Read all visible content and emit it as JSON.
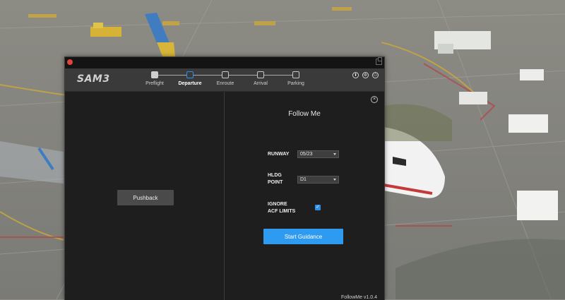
{
  "app": {
    "logo": "SAM3"
  },
  "stepper": {
    "steps": [
      {
        "label": "Preflight",
        "state": "done"
      },
      {
        "label": "Departure",
        "state": "active"
      },
      {
        "label": "Enroute",
        "state": "pending"
      },
      {
        "label": "Arrival",
        "state": "pending"
      },
      {
        "label": "Parking",
        "state": "pending"
      }
    ]
  },
  "header_buttons": [
    {
      "icon": "upload-icon",
      "glyph": "⬆"
    },
    {
      "icon": "settings-icon",
      "glyph": "⚙"
    },
    {
      "icon": "power-icon",
      "glyph": "⏻"
    }
  ],
  "left_panel": {
    "pushback_label": "Pushback"
  },
  "follow_me": {
    "title": "Follow Me",
    "close_glyph": "×",
    "runway": {
      "label": "RUNWAY",
      "value": "05/23"
    },
    "holding_point": {
      "label_line1": "HLDG",
      "label_line2": "POINT",
      "value": "D1"
    },
    "ignore_limits": {
      "label_line1": "IGNORE",
      "label_line2": "ACF LIMITS",
      "checked": true,
      "glyph": "✓"
    },
    "start_label": "Start Guidance",
    "version": "FollowMe v1.0.4"
  },
  "colors": {
    "accent": "#2f9bf0",
    "window_bg": "#1e1e1e",
    "header_bg": "#3a3a3a",
    "close_dot": "#e0433c"
  }
}
